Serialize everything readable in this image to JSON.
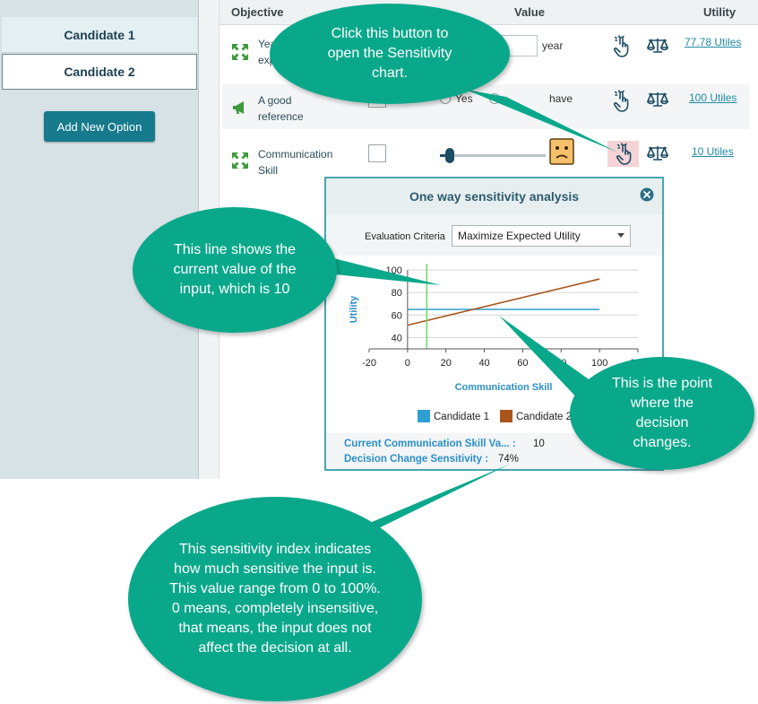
{
  "sidebar": {
    "candidates": [
      "Candidate 1",
      "Candidate 2"
    ],
    "selected": "Candidate 2",
    "add_button": "Add New Option"
  },
  "table": {
    "headers": {
      "objective": "Objective",
      "value": "Value",
      "utility": "Utility"
    },
    "rows": [
      {
        "label_line1": "Yea",
        "label_line2": "exp",
        "value_suffix": "year",
        "utility": "77.78 Utiles",
        "icon": "arrows-expand-icon"
      },
      {
        "label_line1": "A good",
        "label_line2": "reference",
        "option_a": "Yes",
        "option_b": "have",
        "utility": "100 Utiles",
        "icon": "megaphone-icon"
      },
      {
        "label_line1": "Communication",
        "label_line2": "Skill",
        "utility": "10 Utiles",
        "icon": "arrows-expand-icon",
        "slider_value": 0.09,
        "face": "sad-face-icon"
      }
    ]
  },
  "dialog": {
    "title": "One way sensitivity analysis",
    "criteria_label": "Evaluation Criteria",
    "criteria_value": "Maximize Expected Utility",
    "current_label": "Current Communication Skill Va... :",
    "current_value": "10",
    "sensitivity_label": "Decision Change Sensitivity :",
    "sensitivity_value": "74%"
  },
  "chart_data": {
    "type": "line",
    "xlabel": "Communication Skill",
    "ylabel": "Utility",
    "xlim": [
      -20,
      120
    ],
    "ylim": [
      30,
      100
    ],
    "xticks": [
      "-20",
      "0",
      "20",
      "40",
      "60",
      "80",
      "100",
      "120"
    ],
    "yticks": [
      "40",
      "60",
      "80",
      "100"
    ],
    "series": [
      {
        "name": "Candidate 1",
        "color": "#2e9fd0",
        "x": [
          0,
          100
        ],
        "y": [
          65,
          65
        ]
      },
      {
        "name": "Candidate 2",
        "color": "#a9541c",
        "x": [
          0,
          100
        ],
        "y": [
          51,
          92
        ]
      }
    ],
    "current_value_line": {
      "x": 10,
      "color": "#66dd66"
    },
    "grid": true,
    "legend": "bottom"
  },
  "callouts": {
    "top": "Click this button to open the Sensitivity chart.",
    "left": "This line shows the current value of the input, which is 10",
    "right": "This is the point where the decision changes.",
    "bottom": "This sensitivity index indicates how much sensitive the input is. This value range from 0 to 100%. 0 means, completely insensitive, that means, the input does not affect the decision at all."
  },
  "colors": {
    "accent": "#167a8c",
    "callout": "#0aa88b",
    "link": "#1f8aa2",
    "highlight": "#f6d3d6"
  }
}
